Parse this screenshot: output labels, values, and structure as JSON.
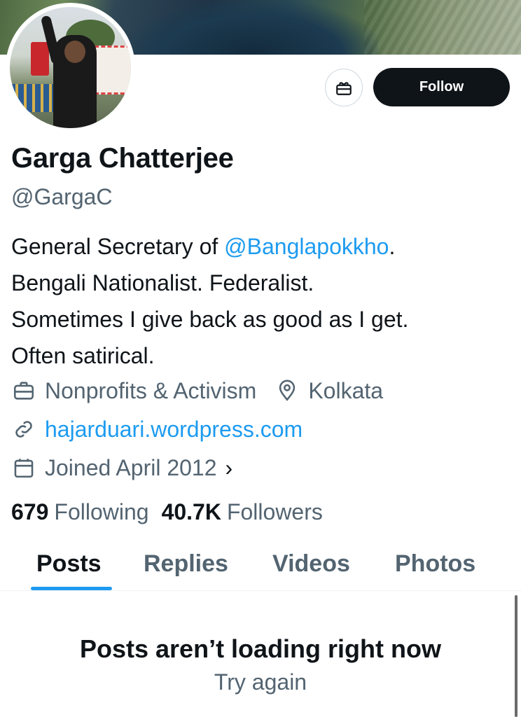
{
  "profile": {
    "name": "Garga Chatterjee",
    "handle": "@GargaC",
    "bio": {
      "prefix": "General Secretary of ",
      "mention": "@Banglapokkho",
      "suffix": ".",
      "lines": [
        "Bengali Nationalist. Federalist.",
        "Sometimes I give back as good as I get.",
        "Often satirical."
      ]
    },
    "category": "Nonprofits & Activism",
    "location": "Kolkata",
    "website": "hajarduari.wordpress.com",
    "joined": "Joined April 2012",
    "joined_chevron": "›",
    "following_count": "679",
    "following_label": "Following",
    "followers_count": "40.7K",
    "followers_label": "Followers"
  },
  "actions": {
    "follow_label": "Follow",
    "gift_icon": "gift-icon"
  },
  "tabs": [
    {
      "label": "Posts",
      "active": true
    },
    {
      "label": "Replies",
      "active": false
    },
    {
      "label": "Videos",
      "active": false
    },
    {
      "label": "Photos",
      "active": false
    }
  ],
  "feed": {
    "error_title": "Posts aren’t loading right now",
    "retry_label": "Try again"
  },
  "colors": {
    "accent": "#1d9bf0",
    "text_primary": "#0f1419",
    "text_secondary": "#536471",
    "follow_button": "#0f1419"
  },
  "icons": [
    "briefcase-icon",
    "location-pin-icon",
    "link-icon",
    "calendar-icon",
    "gift-icon"
  ]
}
